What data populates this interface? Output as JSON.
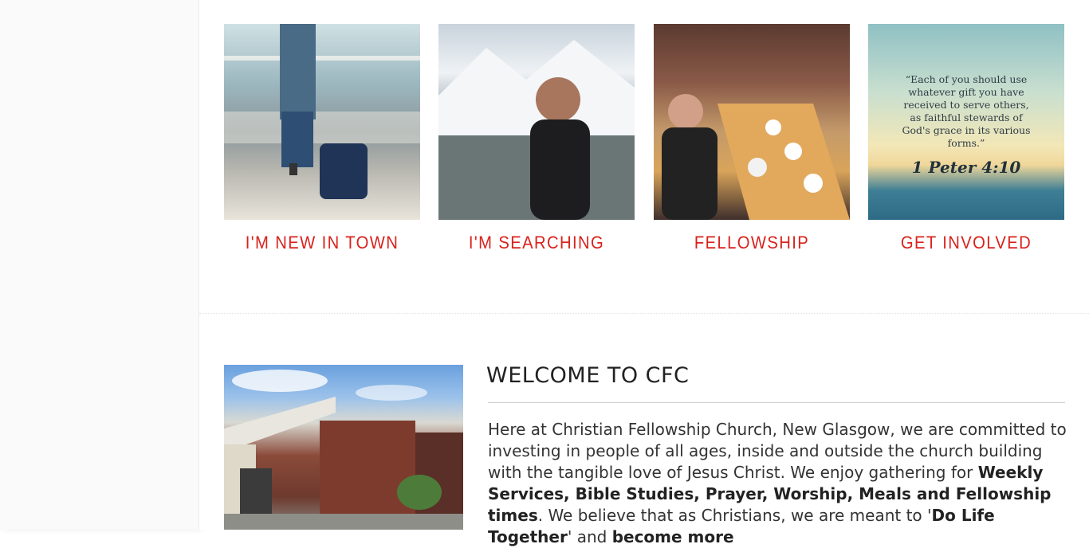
{
  "cards": [
    {
      "label": "I'M NEW IN TOWN",
      "image": "traveler-with-suitcase"
    },
    {
      "label": "I'M SEARCHING",
      "image": "man-looking-at-mountains"
    },
    {
      "label": "FELLOWSHIP",
      "image": "group-eating-at-table"
    },
    {
      "label": "GET INVOLVED",
      "image": "scripture-ocean-sunset"
    }
  ],
  "verse": {
    "quote": "“Each of you should use whatever gift you have received to serve others, as faithful stewards of God's grace in its various forms.”",
    "ref": "1 Peter 4:10"
  },
  "welcome": {
    "title": "WELCOME TO CFC",
    "image": "church-building-photo",
    "p1": "Here at Christian Fellowship Church, New Glasgow, we are committed to investing in people of all ages, inside and outside the church building with the tangible love of Jesus Christ. We enjoy gathering for ",
    "b1": "Weekly Services, Bible Studies, Prayer, Worship, Meals and Fellowship times",
    "p2": ". We believe that as Christians, we are meant to '",
    "b2": "Do Life Together",
    "p3": "' and ",
    "b3": "become more"
  },
  "colors": {
    "accent": "#d9221c",
    "text": "#333333"
  }
}
